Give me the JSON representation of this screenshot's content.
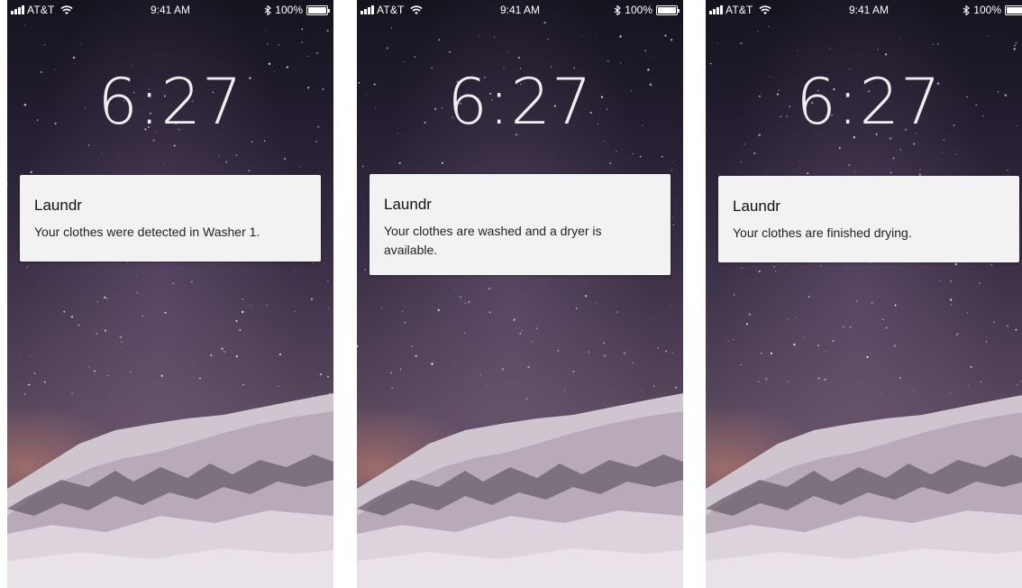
{
  "screens": [
    {
      "status": {
        "carrier": "AT&T",
        "time": "9:41 AM",
        "battery": "100%"
      },
      "lockscreen_time": "6:27",
      "notification": {
        "app": "Laundr",
        "message": "Your clothes were detected in Washer 1."
      }
    },
    {
      "status": {
        "carrier": "AT&T",
        "time": "9:41 AM",
        "battery": "100%"
      },
      "lockscreen_time": "6:27",
      "notification": {
        "app": "Laundr",
        "message": "Your clothes are washed and a dryer is available."
      }
    },
    {
      "status": {
        "carrier": "AT&T",
        "time": "9:41 AM",
        "battery": "100%"
      },
      "lockscreen_time": "6:27",
      "notification": {
        "app": "Laundr",
        "message": "Your clothes are finished drying."
      }
    }
  ],
  "icons": [
    "signal-icon",
    "wifi-icon",
    "bluetooth-icon",
    "battery-icon"
  ],
  "colors": {
    "notification_bg": "#f2f2f2",
    "status_text": "#ffffff"
  }
}
